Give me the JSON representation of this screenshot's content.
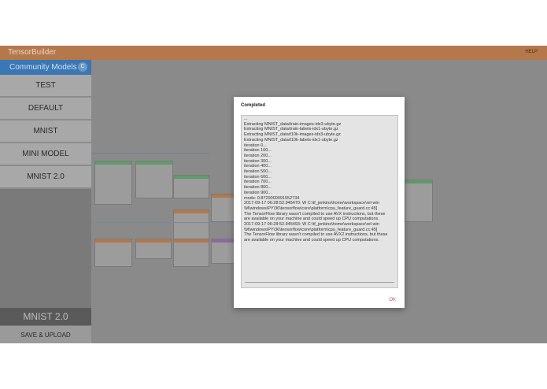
{
  "app": {
    "title": "TensorBuilder",
    "help": "HELP"
  },
  "sidebar": {
    "header": "Community Models",
    "add_icon": "C",
    "items": [
      {
        "label": "TEST"
      },
      {
        "label": "DEFAULT"
      },
      {
        "label": "MNIST"
      },
      {
        "label": "MINI MODEL"
      },
      {
        "label": "MNIST 2.0"
      }
    ],
    "current_model": "MNIST 2.0",
    "save_label": "SAVE & UPLOAD"
  },
  "dialog": {
    "title": "Completed",
    "log_lines": [
      "...",
      "Extracting MNIST_data/train-images-idx3-ubyte.gz",
      "Extracting MNIST_data/train-labels-idx1-ubyte.gz",
      "Extracting MNIST_data/t10k-images-idx3-ubyte.gz",
      "Extracting MNIST_data/t10k-labels-idx1-ubyte.gz",
      "iteration 0...",
      "iteration 100...",
      "iteration 200...",
      "iteration 300...",
      "iteration 400...",
      "iteration 500...",
      "iteration 600...",
      "iteration 700...",
      "iteration 800...",
      "iteration 900...",
      "mode: 0.8729000091552734",
      "2017-09-17 06:28:52.945470: W C:\\tf_jenkins\\home\\workspace\\rel-win",
      "\\M\\windows\\PY\\36\\tensorflow\\core\\platform\\cpu_feature_guard.cc:45]",
      "The TensorFlow library wasn't compiled to use AVX instructions, but these",
      "are available on your machine and could speed up CPU computations.",
      "2017-09-17 06:28:52.945493: W C:\\tf_jenkins\\home\\workspace\\rel-win",
      "\\M\\windows\\PY\\36\\tensorflow\\core\\platform\\cpu_feature_guard.cc:45]",
      "The TensorFlow library wasn't compiled to use AVX2 instructions, but these",
      "are available on your machine and could speed up CPU computations."
    ],
    "ok_label": "OK"
  },
  "colors": {
    "topbar": "#b5784a",
    "sidebar_header": "#3a77b4",
    "ok_text": "#d64a4a"
  }
}
